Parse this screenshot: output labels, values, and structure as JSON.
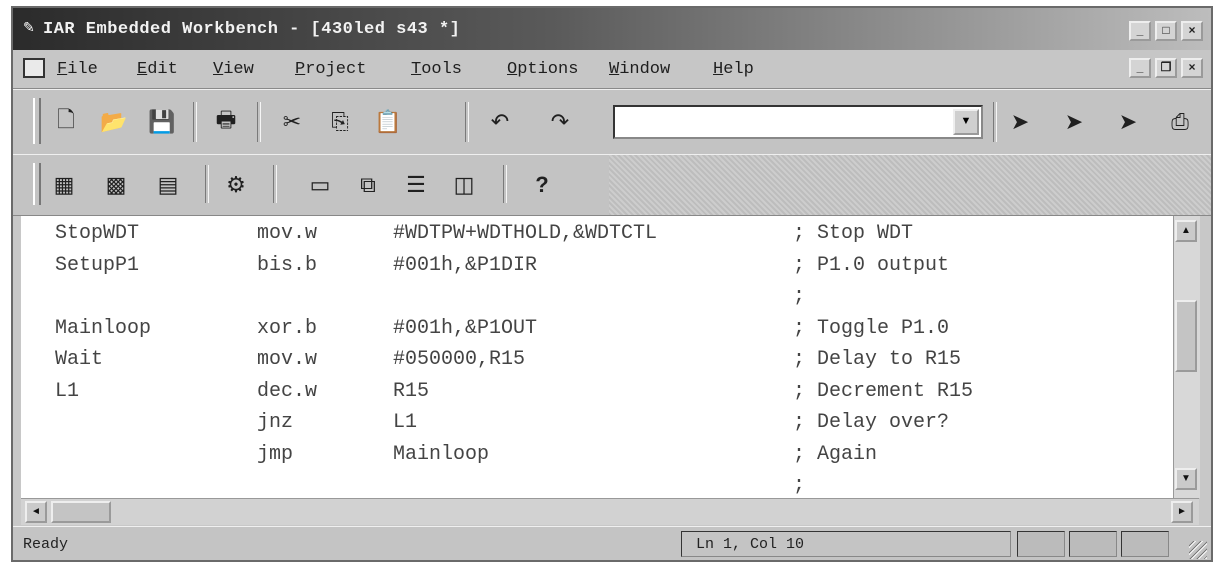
{
  "window": {
    "title": "IAR Embedded Workbench - [430led s43 *]",
    "app_icon": "iar-icon",
    "controls": {
      "minimize": "_",
      "maximize": "□",
      "close": "×"
    }
  },
  "menubar": {
    "items": [
      "File",
      "Edit",
      "View",
      "Project",
      "Tools",
      "Options",
      "Window",
      "Help"
    ],
    "doc_controls": {
      "minimize": "_",
      "restore": "❐",
      "close": "×"
    }
  },
  "toolbar1": {
    "icons": {
      "new": "🗋",
      "open": "📂",
      "save": "💾",
      "print": "🖶",
      "cut": "✂",
      "copy": "⎘",
      "paste": "📋",
      "undo": "↶",
      "redo": "↷",
      "find": "⌕"
    },
    "combo_value": "",
    "combo_arrow": "▼"
  },
  "toolbar2": {
    "icons": {
      "compile": "▦",
      "make": "▩",
      "link": "▤",
      "debug": "⚙",
      "window1": "▭",
      "window2": "⧉",
      "window3": "☰",
      "window4": "◫",
      "help": "?"
    }
  },
  "editor": {
    "lines": [
      {
        "label": "StopWDT",
        "op": "mov.w",
        "arg": "#WDTPW+WDTHOLD,&WDTCTL",
        "comment": "; Stop WDT"
      },
      {
        "label": "SetupP1",
        "op": "bis.b",
        "arg": "#001h,&P1DIR",
        "comment": "; P1.0 output"
      },
      {
        "label": "",
        "op": "",
        "arg": "",
        "comment": ";"
      },
      {
        "label": "Mainloop",
        "op": "xor.b",
        "arg": "#001h,&P1OUT",
        "comment": "; Toggle P1.0"
      },
      {
        "label": "Wait",
        "op": "mov.w",
        "arg": "#050000,R15",
        "comment": "; Delay to R15"
      },
      {
        "label": "L1",
        "op": "dec.w",
        "arg": "R15",
        "comment": "; Decrement R15"
      },
      {
        "label": "",
        "op": "jnz",
        "arg": "L1",
        "comment": "; Delay over?"
      },
      {
        "label": "",
        "op": "jmp",
        "arg": "Mainloop",
        "comment": "; Again"
      },
      {
        "label": "",
        "op": "",
        "arg": "",
        "comment": ";"
      }
    ]
  },
  "scroll": {
    "up": "▲",
    "down": "▼",
    "left": "◄",
    "right": "►"
  },
  "statusbar": {
    "left": "Ready",
    "position": "Ln 1, Col 10"
  }
}
